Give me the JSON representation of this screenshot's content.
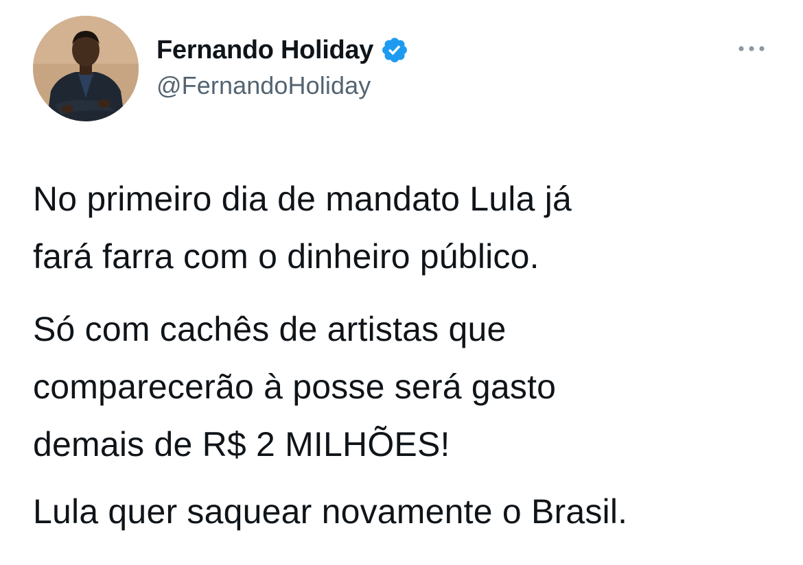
{
  "author": {
    "display_name": "Fernando Holiday",
    "handle": "@FernandoHoliday",
    "verified": true,
    "verified_icon": "verified-badge-icon",
    "avatar_icon": "profile-photo"
  },
  "menu": {
    "icon": "more-options-icon"
  },
  "tweet": {
    "paragraphs": [
      {
        "lines": [
          "No primeiro dia de mandato Lula já",
          "fará farra com o dinheiro público."
        ]
      },
      {
        "lines": [
          "Só com cachês de artistas que",
          "comparecerão à posse será gasto",
          "demais de R$ 2 MILHÕES!"
        ]
      },
      {
        "lines": [
          "Lula quer saquear novamente o Brasil."
        ]
      }
    ]
  },
  "colors": {
    "text": "#0f1419",
    "secondary_text": "#536471",
    "verified_blue": "#1d9bf0",
    "background": "#ffffff"
  }
}
